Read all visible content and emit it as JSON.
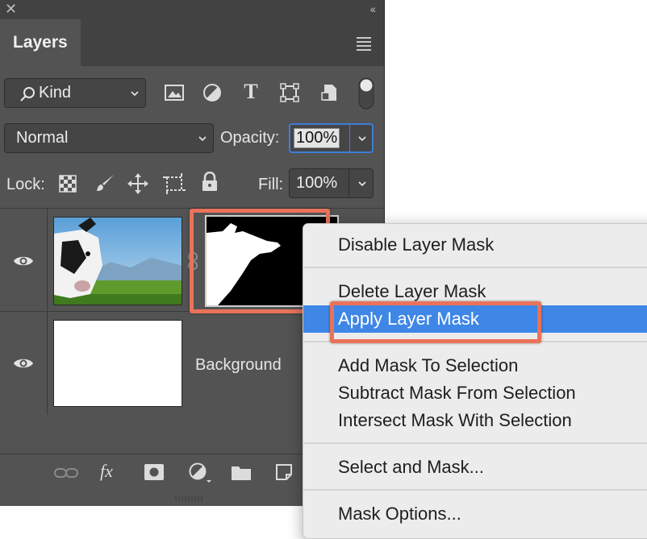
{
  "window": {
    "close_glyph": "✕",
    "collapse_glyph": "‹‹"
  },
  "panel": {
    "tab_title": "Layers",
    "filter": {
      "selected": "Kind"
    },
    "blend_mode": {
      "selected": "Normal"
    },
    "opacity": {
      "label": "Opacity:",
      "value": "100%"
    },
    "lock": {
      "label": "Lock:"
    },
    "fill": {
      "label": "Fill:",
      "value": "100%"
    }
  },
  "layers": [
    {
      "name": "",
      "type": "photo-with-mask",
      "visible": true
    },
    {
      "name": "Background",
      "type": "background",
      "visible": true
    }
  ],
  "bottom_toolbar": {
    "fx_label": "fx"
  },
  "context_menu": {
    "items": [
      {
        "label": "Disable Layer Mask"
      },
      {
        "label": "Delete Layer Mask"
      },
      {
        "label": "Apply Layer Mask",
        "selected": true
      },
      {
        "label": "Add Mask To Selection"
      },
      {
        "label": "Subtract Mask From Selection"
      },
      {
        "label": "Intersect Mask With Selection"
      },
      {
        "label": "Select and Mask..."
      },
      {
        "label": "Mask Options..."
      }
    ]
  },
  "colors": {
    "panel_bg": "#535353",
    "menu_selection": "#3f87e6",
    "highlight_annotation": "#e9735a"
  }
}
